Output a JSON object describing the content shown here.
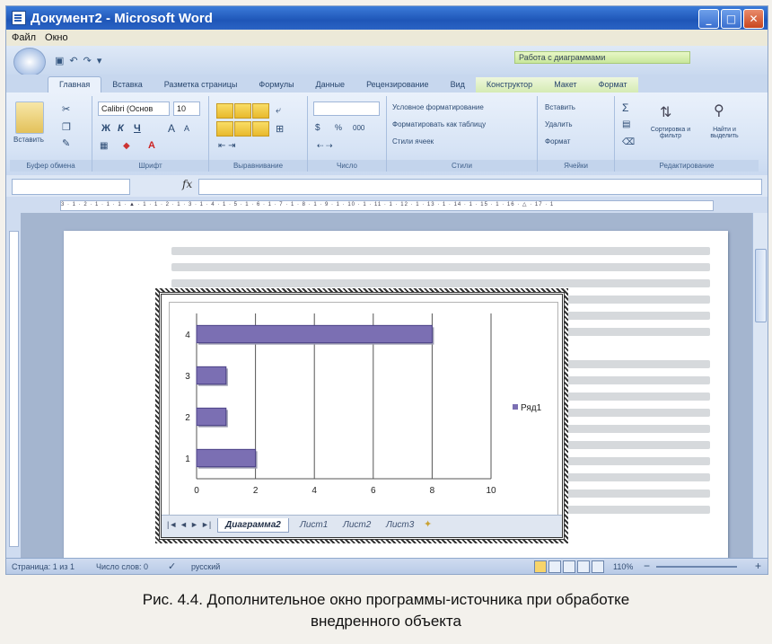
{
  "window": {
    "title": "Документ2 - Microsoft Word",
    "min": "_",
    "max": "□",
    "close": "✕"
  },
  "menu": {
    "file": "Файл",
    "window": "Окно"
  },
  "qat": {
    "context_label": "Работа с диаграммами"
  },
  "tabs": [
    "Главная",
    "Вставка",
    "Разметка страницы",
    "Формулы",
    "Данные",
    "Рецензирование",
    "Вид",
    "Конструктор",
    "Макет",
    "Формат"
  ],
  "ribbon": {
    "clipboard": {
      "paste": "Вставить",
      "label": "Буфер обмена"
    },
    "font": {
      "name": "Calibri (Основ",
      "size": "10",
      "bold": "Ж",
      "italic": "К",
      "underline": "Ч",
      "grow": "A",
      "shrink": "A",
      "label": "Шрифт"
    },
    "align": {
      "label": "Выравнивание"
    },
    "number": {
      "label": "Число",
      "percent": "%",
      "thousands": "000"
    },
    "styles": {
      "cond": "Условное форматирование",
      "table": "Форматировать как таблицу",
      "cell": "Стили ячеек",
      "label": "Стили"
    },
    "cells": {
      "insert": "Вставить",
      "delete": "Удалить",
      "format": "Формат",
      "label": "Ячейки"
    },
    "edit": {
      "sigma": "Σ",
      "sort": "Сортировка и фильтр",
      "find": "Найти и выделить",
      "label": "Редактирование"
    }
  },
  "formula": {
    "fx": "fx"
  },
  "ruler": {
    "marks": "3 · 1 · 2 · 1 · 1 · 1 · ▲ · 1 · 1 · 2 · 1 · 3 · 1 · 4 · 1 · 5 · 1 · 6 · 1 · 7 · 1 · 8 · 1 · 9 · 1 · 10 · 1 · 11 · 1 · 12 · 1 · 13 · 1 · 14 · 1 · 15 · 1 · 16 · △ · 17 · 1"
  },
  "chart_data": {
    "type": "bar",
    "orientation": "horizontal",
    "categories": [
      "1",
      "2",
      "3",
      "4"
    ],
    "series": [
      {
        "name": "Ряд1",
        "values": [
          2,
          1,
          1,
          8
        ],
        "color": "#7b6fb3"
      }
    ],
    "xlim": [
      0,
      10
    ],
    "xticks": [
      "0",
      "2",
      "4",
      "6",
      "8",
      "10"
    ],
    "grid": true,
    "legend": "right"
  },
  "sheets": {
    "nav": [
      "|◄",
      "◄",
      "►",
      "►|"
    ],
    "tabs": [
      "Диаграмма2",
      "Лист1",
      "Лист2",
      "Лист3"
    ]
  },
  "status": {
    "page": "Страница: 1 из 1",
    "words": "Число слов: 0",
    "lang": "русский",
    "zoom": "110%",
    "zoom_minus": "−",
    "zoom_plus": "+"
  },
  "caption": {
    "line1": "Рис. 4.4. Дополнительное окно программы-источника при обработке",
    "line2": "внедренного объекта"
  }
}
